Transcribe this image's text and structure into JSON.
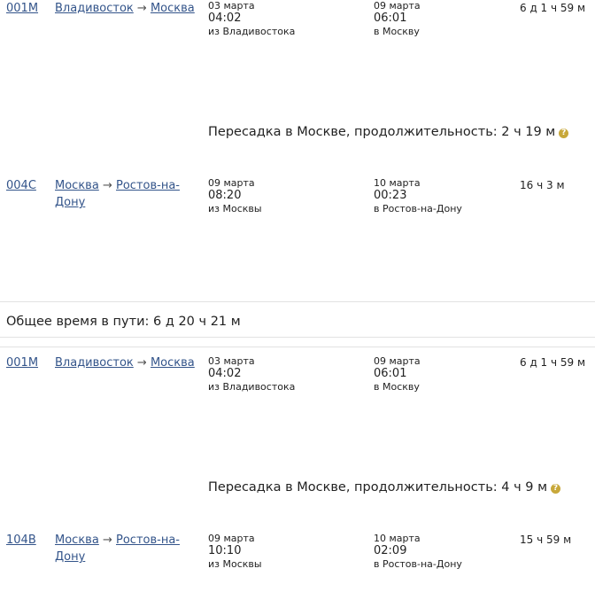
{
  "trip1": {
    "leg1": {
      "train": "001М",
      "from": "Владивосток",
      "arrow": "→",
      "to": "Москва",
      "dep_date": "03 марта",
      "dep_time": "04:02",
      "dep_station": "из Владивостока",
      "arr_date": "09 марта",
      "arr_time": "06:01",
      "arr_station": "в Москву",
      "duration": "6 д 1 ч 59 м"
    },
    "transfer": {
      "text": "Пересадка в Москве, продолжительность: 2 ч 19 м",
      "icon": "?"
    },
    "leg2": {
      "train": "004С",
      "from": "Москва",
      "arrow": "→",
      "to": "Ростов-на-Дону",
      "dep_date": "09 марта",
      "dep_time": "08:20",
      "dep_station": "из Москвы",
      "arr_date": "10 марта",
      "arr_time": "00:23",
      "arr_station": "в Ростов-на-Дону",
      "duration": "16 ч 3 м"
    },
    "total": "Общее время в пути: 6 д 20 ч 21 м"
  },
  "trip2": {
    "leg1": {
      "train": "001М",
      "from": "Владивосток",
      "arrow": "→",
      "to": "Москва",
      "dep_date": "03 марта",
      "dep_time": "04:02",
      "dep_station": "из Владивостока",
      "arr_date": "09 марта",
      "arr_time": "06:01",
      "arr_station": "в Москву",
      "duration": "6 д 1 ч 59 м"
    },
    "transfer": {
      "text": "Пересадка в Москве, продолжительность: 4 ч 9 м",
      "icon": "?"
    },
    "leg2": {
      "train": "104В",
      "from": "Москва",
      "arrow": "→",
      "to": "Ростов-на-Дону",
      "dep_date": "09 марта",
      "dep_time": "10:10",
      "dep_station": "из Москвы",
      "arr_date": "10 марта",
      "arr_time": "02:09",
      "arr_station": "в Ростов-на-Дону",
      "duration": "15 ч 59 м"
    }
  }
}
